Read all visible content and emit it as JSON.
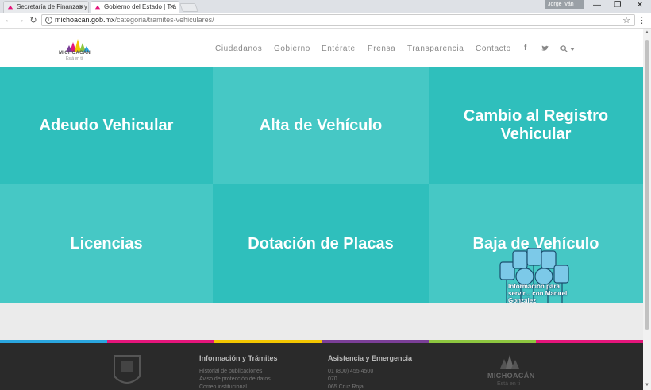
{
  "browser": {
    "tabs": [
      {
        "title": "Secretaría de Finanzas y"
      },
      {
        "title": "Gobierno del Estado | Trá"
      }
    ],
    "profile": "Jorge Iván",
    "url_host": "michoacan.gob.mx",
    "url_path": "/categoria/tramites-vehiculares/",
    "controls": {
      "minimize": "—",
      "restore": "❐",
      "close": "✕"
    }
  },
  "site": {
    "logo_text": "MICHOACÁN",
    "logo_sub": "Está en ti",
    "nav": [
      "Ciudadanos",
      "Gobierno",
      "Entérate",
      "Prensa",
      "Transparencia",
      "Contacto"
    ],
    "nav_icons": [
      "facebook-icon",
      "twitter-icon",
      "search-icon"
    ],
    "brand_colors": [
      "#2fbfbc",
      "#46c8c5",
      "#e4157b",
      "#f2c500",
      "#8dc63f",
      "#2aa6df"
    ]
  },
  "tiles": [
    {
      "label": "Adeudo Vehicular"
    },
    {
      "label": "Alta de Vehículo"
    },
    {
      "label": "Cambio al Registro Vehicular"
    },
    {
      "label": "Licencias"
    },
    {
      "label": "Dotación de Placas"
    },
    {
      "label": "Baja de Vehículo"
    }
  ],
  "overlay": {
    "text": "Información para servir... con Manuel González"
  },
  "footer": {
    "col1": {
      "heading": "Información y Trámites",
      "links": [
        "Historial de publicaciones",
        "Aviso de protección de datos",
        "Correo institucional"
      ]
    },
    "col2": {
      "heading": "Asistencia y Emergencia",
      "lines": [
        "01 (800) 455 4500",
        "070",
        "065 Cruz Roja"
      ]
    },
    "logo_text": "MICHOACÁN",
    "logo_sub": "Está en ti"
  }
}
